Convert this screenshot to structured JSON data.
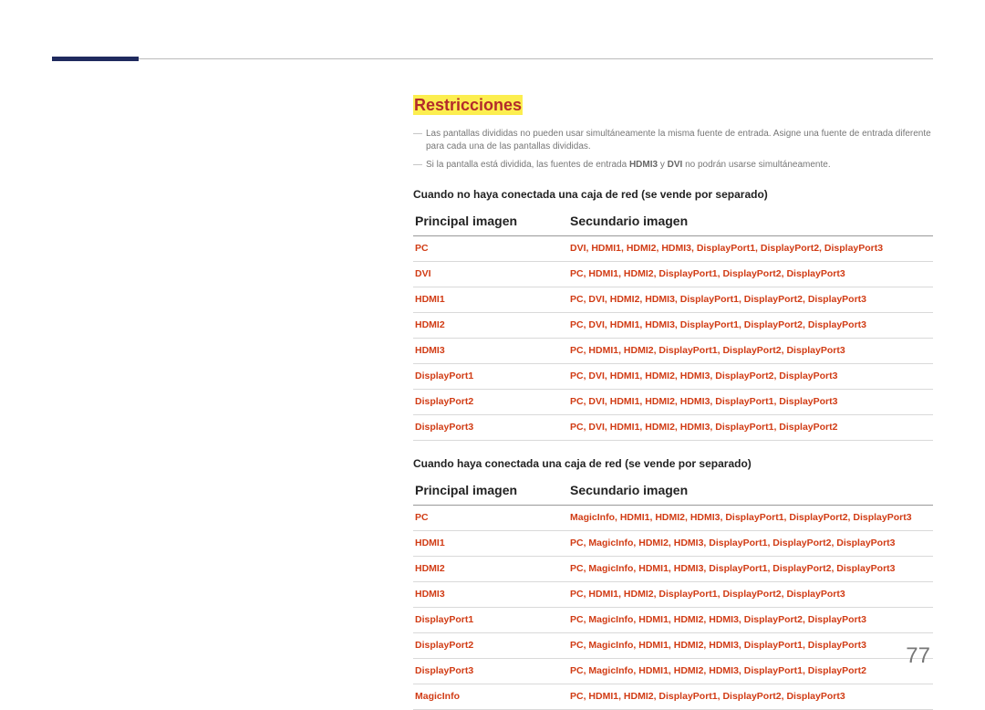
{
  "heading": "Restricciones",
  "notes": [
    {
      "pre": "Las pantallas divididas no pueden usar simultáneamente la misma fuente de entrada. Asigne una fuente de entrada diferente para cada una de las pantallas divididas."
    },
    {
      "pre": "Si la pantalla está dividida, las fuentes de entrada ",
      "b1": "HDMI3",
      "mid": " y ",
      "b2": "DVI",
      "post": " no podrán usarse simultáneamente."
    }
  ],
  "sections": [
    {
      "caption": "Cuando no haya conectada una caja de red (se vende por separado)",
      "col1": "Principal imagen",
      "col2": "Secundario imagen",
      "rows": [
        {
          "a": "PC",
          "b": "DVI, HDMI1, HDMI2, HDMI3, DisplayPort1, DisplayPort2, DisplayPort3"
        },
        {
          "a": "DVI",
          "b": "PC, HDMI1, HDMI2, DisplayPort1, DisplayPort2, DisplayPort3"
        },
        {
          "a": "HDMI1",
          "b": "PC, DVI, HDMI2, HDMI3, DisplayPort1, DisplayPort2, DisplayPort3"
        },
        {
          "a": "HDMI2",
          "b": "PC, DVI, HDMI1, HDMI3, DisplayPort1, DisplayPort2, DisplayPort3"
        },
        {
          "a": "HDMI3",
          "b": "PC, HDMI1, HDMI2, DisplayPort1, DisplayPort2, DisplayPort3"
        },
        {
          "a": "DisplayPort1",
          "b": "PC, DVI, HDMI1, HDMI2, HDMI3, DisplayPort2, DisplayPort3"
        },
        {
          "a": "DisplayPort2",
          "b": "PC, DVI, HDMI1, HDMI2, HDMI3, DisplayPort1, DisplayPort3"
        },
        {
          "a": "DisplayPort3",
          "b": "PC, DVI, HDMI1, HDMI2, HDMI3, DisplayPort1, DisplayPort2"
        }
      ]
    },
    {
      "caption": "Cuando haya conectada una caja de red (se vende por separado)",
      "col1": "Principal imagen",
      "col2": "Secundario imagen",
      "rows": [
        {
          "a": "PC",
          "b": "MagicInfo, HDMI1, HDMI2, HDMI3, DisplayPort1, DisplayPort2, DisplayPort3"
        },
        {
          "a": "HDMI1",
          "b": "PC, MagicInfo, HDMI2, HDMI3, DisplayPort1, DisplayPort2, DisplayPort3"
        },
        {
          "a": "HDMI2",
          "b": "PC, MagicInfo, HDMI1, HDMI3, DisplayPort1, DisplayPort2, DisplayPort3"
        },
        {
          "a": "HDMI3",
          "b": "PC, HDMI1, HDMI2, DisplayPort1, DisplayPort2, DisplayPort3"
        },
        {
          "a": "DisplayPort1",
          "b": "PC, MagicInfo, HDMI1, HDMI2, HDMI3, DisplayPort2, DisplayPort3"
        },
        {
          "a": "DisplayPort2",
          "b": "PC, MagicInfo, HDMI1, HDMI2, HDMI3, DisplayPort1, DisplayPort3"
        },
        {
          "a": "DisplayPort3",
          "b": "PC, MagicInfo, HDMI1, HDMI2, HDMI3, DisplayPort1, DisplayPort2"
        },
        {
          "a": "MagicInfo",
          "b": "PC, HDMI1, HDMI2, DisplayPort1, DisplayPort2, DisplayPort3"
        }
      ]
    }
  ],
  "page": "77"
}
